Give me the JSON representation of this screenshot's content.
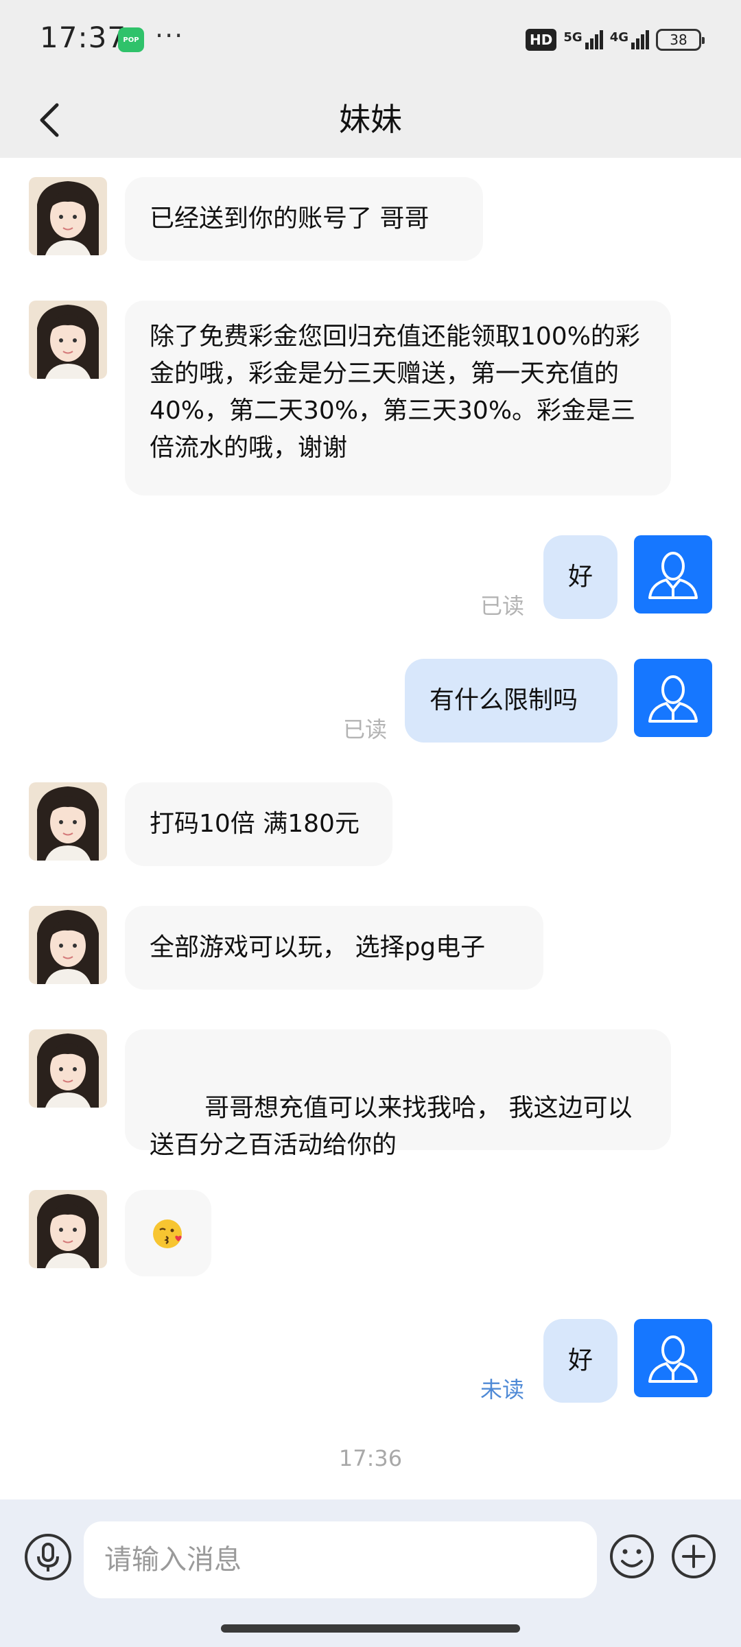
{
  "status_bar": {
    "time": "17:37",
    "notification_icon": "pop-app-icon",
    "notification_icon_text": "POP",
    "more": "···",
    "hd": "HD",
    "network_5g": "5G",
    "network_4g": "4G",
    "battery": "38"
  },
  "header": {
    "back_icon": "chevron-left-icon",
    "title": "妹妹"
  },
  "messages": [
    {
      "sender": "contact",
      "text": "已经送到你的账号了 哥哥"
    },
    {
      "sender": "contact",
      "text": "除了免费彩金您回归充值还能领取100%的彩金的哦，彩金是分三天赠送，第一天充值的40%，第二天30%，第三天30%。彩金是三倍流水的哦，谢谢"
    },
    {
      "sender": "self",
      "text": "好",
      "status": "已读"
    },
    {
      "sender": "self",
      "text": "有什么限制吗",
      "status": "已读"
    },
    {
      "sender": "contact",
      "text": "打码10倍 满180元"
    },
    {
      "sender": "contact",
      "text": "全部游戏可以玩， 选择pg电子"
    },
    {
      "sender": "contact",
      "text": " 哥哥想充值可以来找我哈， 我这边可以送百分之百活动给你的"
    },
    {
      "sender": "contact",
      "text": "😘"
    },
    {
      "sender": "self",
      "text": "好",
      "status": "未读"
    }
  ],
  "timestamp": "17:36",
  "input_bar": {
    "placeholder": "请输入消息",
    "voice_icon": "microphone-icon",
    "emoji_icon": "smiley-icon",
    "plus_icon": "plus-icon"
  },
  "colors": {
    "self_avatar": "#1677ff",
    "self_bubble": "#d8e7fb",
    "contact_bubble": "#f7f7f7",
    "unread_label": "#4f8ad6",
    "read_label": "#b3b3b3"
  }
}
